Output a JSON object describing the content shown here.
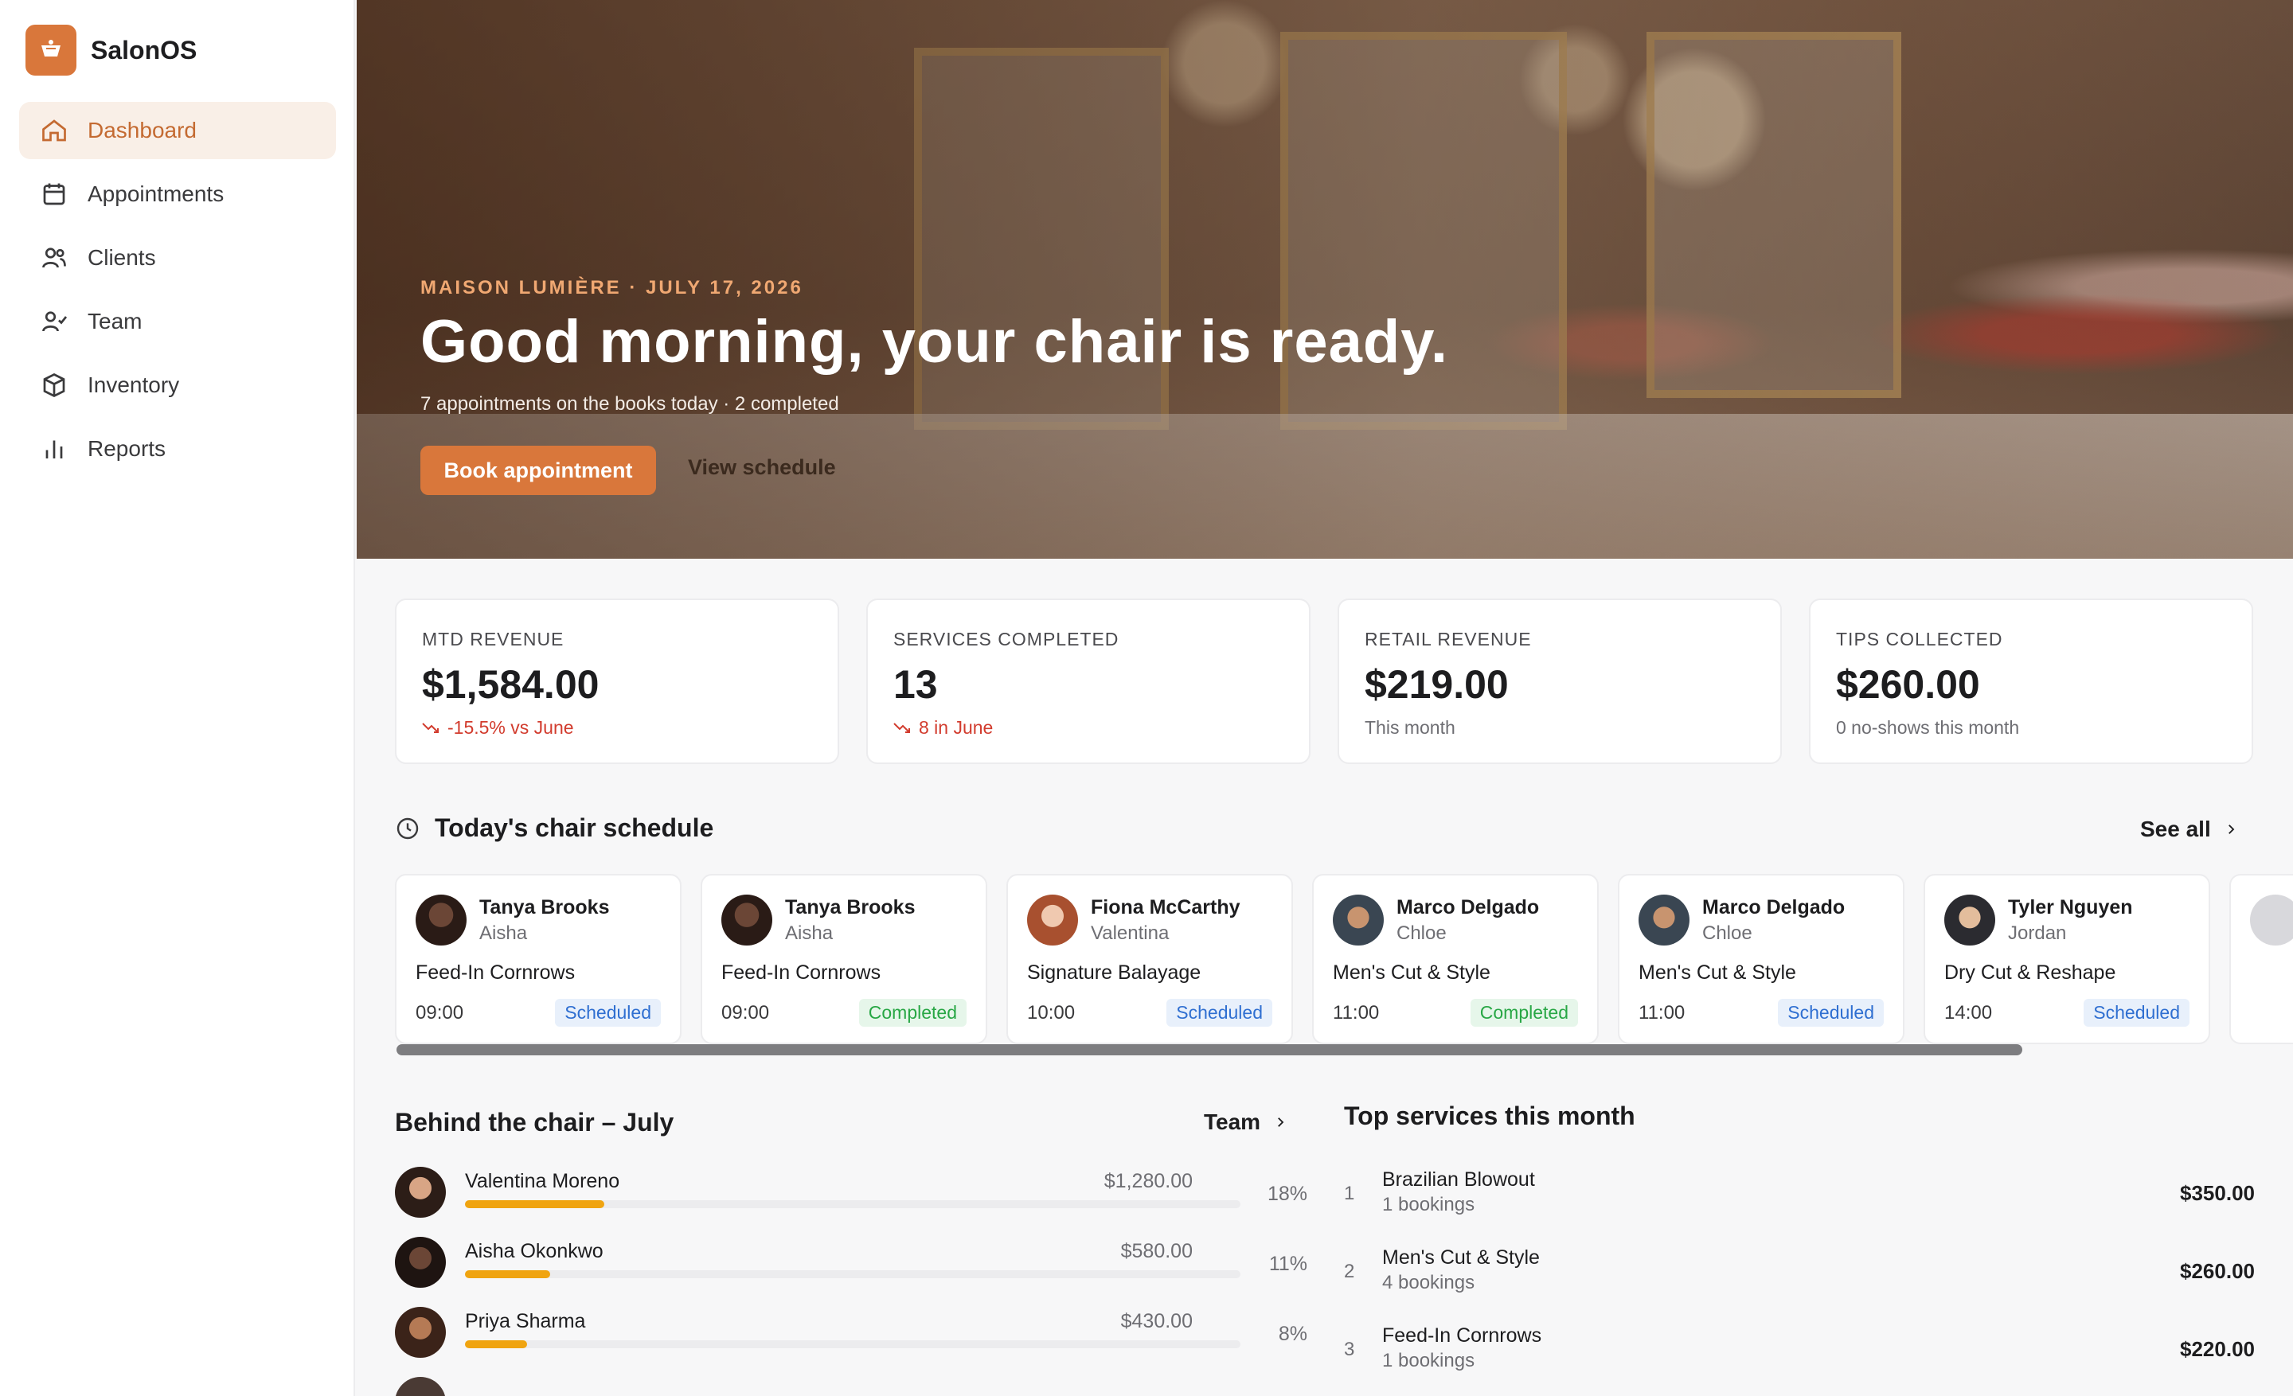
{
  "brand": {
    "name": "SalonOS",
    "accent": "#d9773b"
  },
  "sidebar": {
    "items": [
      {
        "label": "Dashboard",
        "icon": "home-icon",
        "active": true
      },
      {
        "label": "Appointments",
        "icon": "calendar-icon"
      },
      {
        "label": "Clients",
        "icon": "users-icon"
      },
      {
        "label": "Team",
        "icon": "user-check-icon"
      },
      {
        "label": "Inventory",
        "icon": "box-icon"
      },
      {
        "label": "Reports",
        "icon": "bar-chart-icon"
      }
    ]
  },
  "hero": {
    "eyebrow": "MAISON LUMIÈRE · JULY 17, 2026",
    "title": "Good morning, your chair is ready.",
    "subtitle": "7 appointments on the books today · 2 completed",
    "primary_button": "Book appointment",
    "secondary_link": "View schedule"
  },
  "kpis": [
    {
      "label": "MTD REVENUE",
      "value": "$1,584.00",
      "sub": "-15.5% vs June",
      "trend": "down"
    },
    {
      "label": "SERVICES COMPLETED",
      "value": "13",
      "sub": "8 in June",
      "trend": "down"
    },
    {
      "label": "RETAIL REVENUE",
      "value": "$219.00",
      "sub": "This month",
      "trend": "none"
    },
    {
      "label": "TIPS COLLECTED",
      "value": "$260.00",
      "sub": "0 no-shows this month",
      "trend": "none"
    }
  ],
  "schedule": {
    "title": "Today's chair schedule",
    "see_all": "See all",
    "appointments": [
      {
        "client": "Tanya Brooks",
        "stylist": "Aisha",
        "service": "Feed-In Cornrows",
        "time": "09:00",
        "status": "Scheduled"
      },
      {
        "client": "Tanya Brooks",
        "stylist": "Aisha",
        "service": "Feed-In Cornrows",
        "time": "09:00",
        "status": "Completed"
      },
      {
        "client": "Fiona McCarthy",
        "stylist": "Valentina",
        "service": "Signature Balayage",
        "time": "10:00",
        "status": "Scheduled"
      },
      {
        "client": "Marco Delgado",
        "stylist": "Chloe",
        "service": "Men's Cut & Style",
        "time": "11:00",
        "status": "Completed"
      },
      {
        "client": "Marco Delgado",
        "stylist": "Chloe",
        "service": "Men's Cut & Style",
        "time": "11:00",
        "status": "Scheduled"
      },
      {
        "client": "Tyler Nguyen",
        "stylist": "Jordan",
        "service": "Dry Cut & Reshape",
        "time": "14:00",
        "status": "Scheduled"
      }
    ]
  },
  "behind_chair": {
    "title": "Behind the chair – July",
    "team_link": "Team",
    "stylists": [
      {
        "name": "Valentina Moreno",
        "amount": "$1,280.00",
        "pct": "18%",
        "share": 0.18
      },
      {
        "name": "Aisha Okonkwo",
        "amount": "$580.00",
        "pct": "11%",
        "share": 0.11
      },
      {
        "name": "Priya Sharma",
        "amount": "$430.00",
        "pct": "8%",
        "share": 0.08
      }
    ]
  },
  "top_services": {
    "title": "Top services this month",
    "items": [
      {
        "rank": "1",
        "name": "Brazilian Blowout",
        "count": "1 bookings",
        "amount": "$350.00"
      },
      {
        "rank": "2",
        "name": "Men's Cut & Style",
        "count": "4 bookings",
        "amount": "$260.00"
      },
      {
        "rank": "3",
        "name": "Feed-In Cornrows",
        "count": "1 bookings",
        "amount": "$220.00"
      }
    ]
  }
}
